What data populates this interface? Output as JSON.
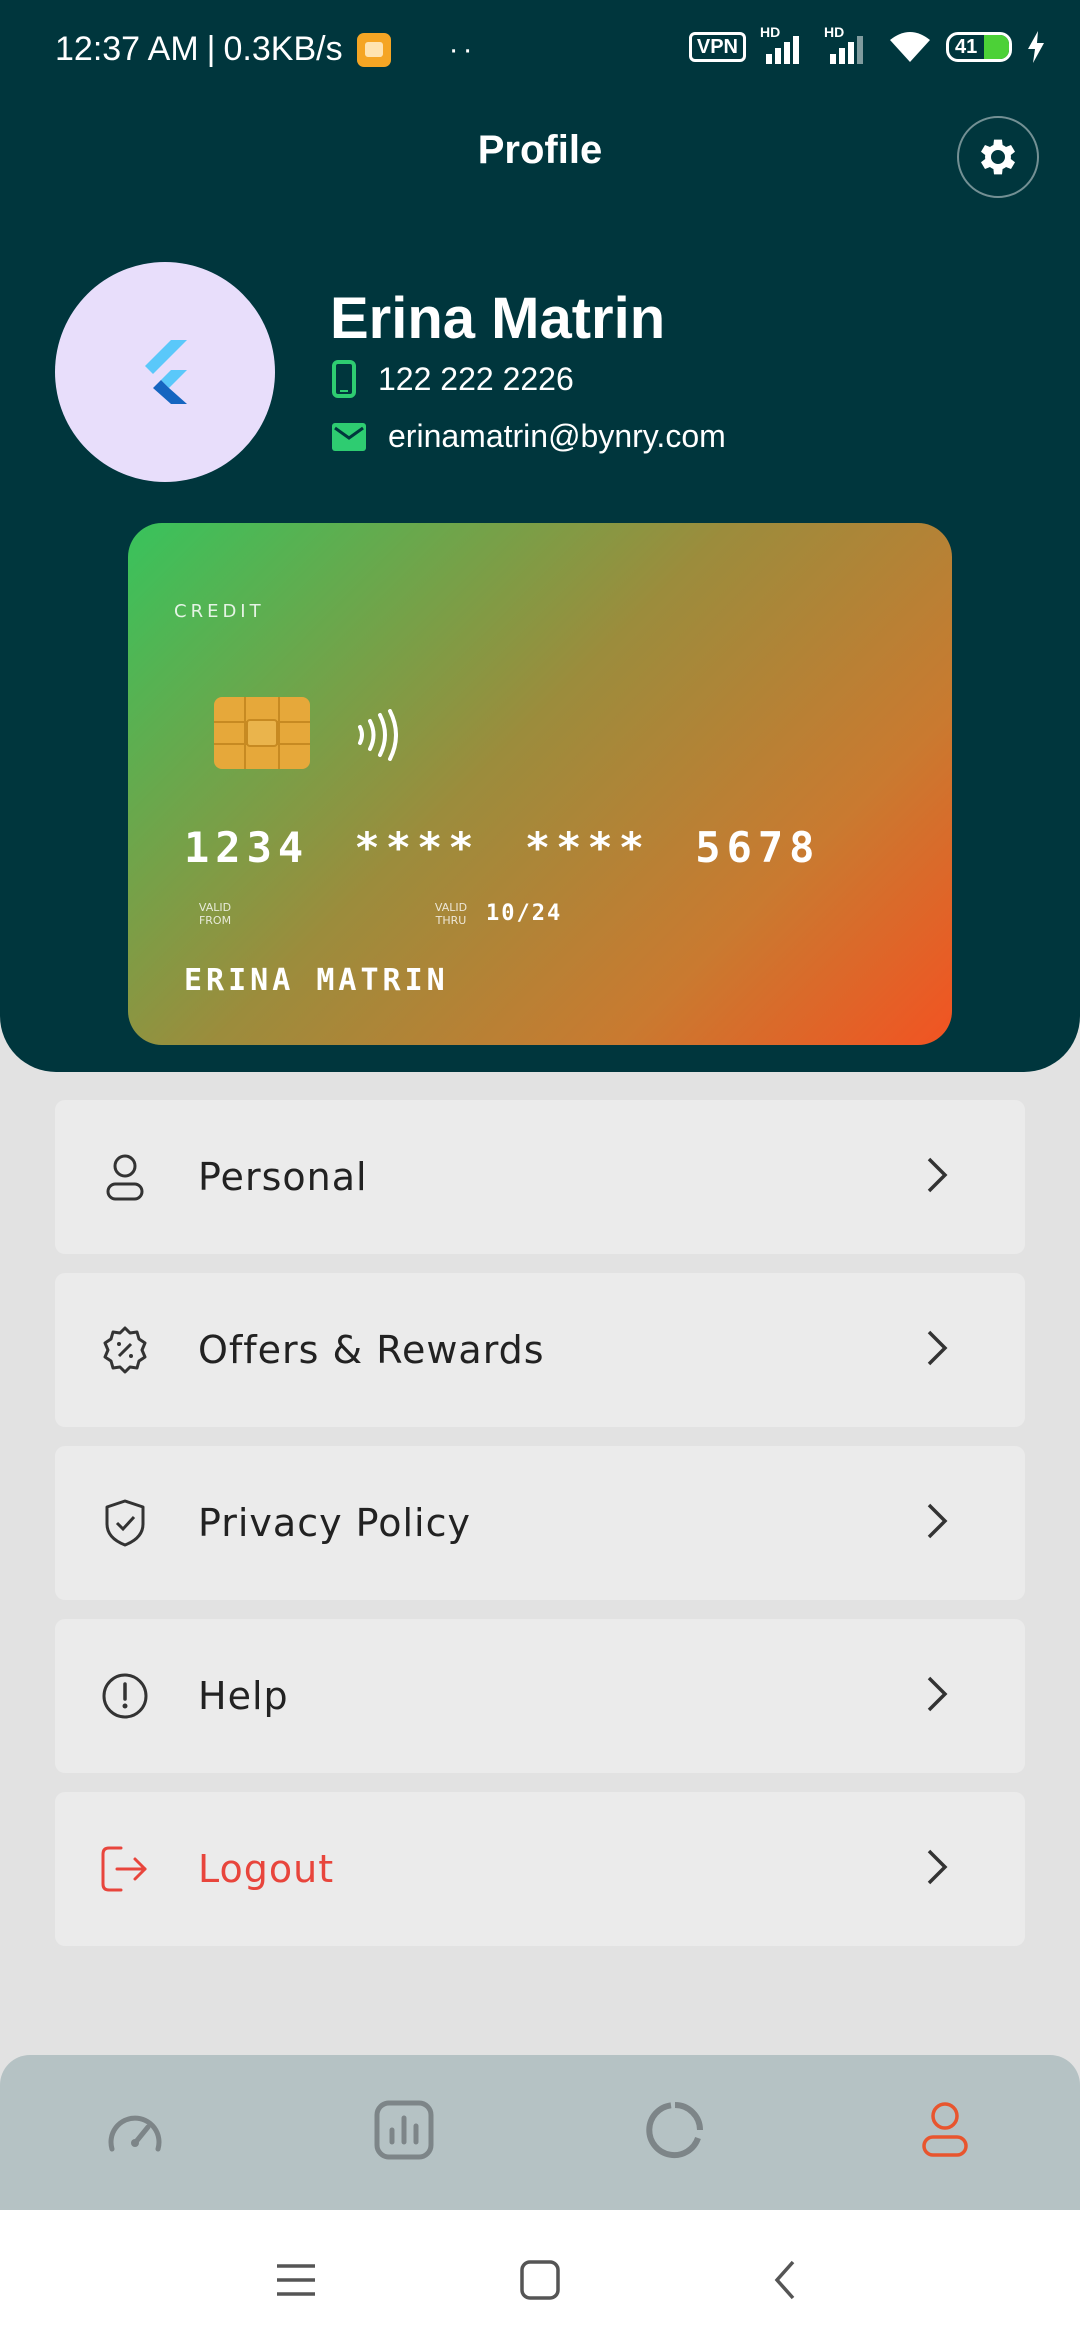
{
  "status_bar": {
    "time": "12:37 AM",
    "separator": "|",
    "speed": "0.3KB/s",
    "dots": "··",
    "vpn": "VPN",
    "hd1": "HD",
    "hd2": "HD",
    "battery": "41",
    "battery_level": 0.41
  },
  "header": {
    "title": "Profile",
    "settings_icon": "gear-icon"
  },
  "profile": {
    "avatar_icon": "flutter-logo",
    "name": "Erina Matrin",
    "phone": "122 222 2226",
    "email": "erinamatrin@bynry.com"
  },
  "card": {
    "type": "CREDIT",
    "number": "1234 **** **** 5678",
    "valid_from_label_1": "VALID",
    "valid_from_label_2": "FROM",
    "valid_thru_label_1": "VALID",
    "valid_thru_label_2": "THRU",
    "valid_thru": "10/24",
    "holder": "ERINA MATRIN"
  },
  "menu": {
    "items": [
      {
        "label": "Personal",
        "icon": "user-icon"
      },
      {
        "label": "Offers & Rewards",
        "icon": "discount-badge-icon"
      },
      {
        "label": "Privacy Policy",
        "icon": "shield-check-icon"
      },
      {
        "label": "Help",
        "icon": "info-icon"
      },
      {
        "label": "Logout",
        "icon": "logout-icon",
        "color": "#e8453c"
      }
    ]
  },
  "bottom_nav": {
    "items": [
      {
        "icon": "speedometer-icon",
        "active": false
      },
      {
        "icon": "bar-chart-icon",
        "active": false
      },
      {
        "icon": "donut-chart-icon",
        "active": false
      },
      {
        "icon": "profile-icon",
        "active": true
      }
    ],
    "active_color": "#e8552e",
    "inactive_color": "#7d8588"
  },
  "colors": {
    "header_bg": "#00363d",
    "accent": "#e8552e",
    "danger": "#e8453c",
    "contact_icon": "#2ecc71"
  }
}
